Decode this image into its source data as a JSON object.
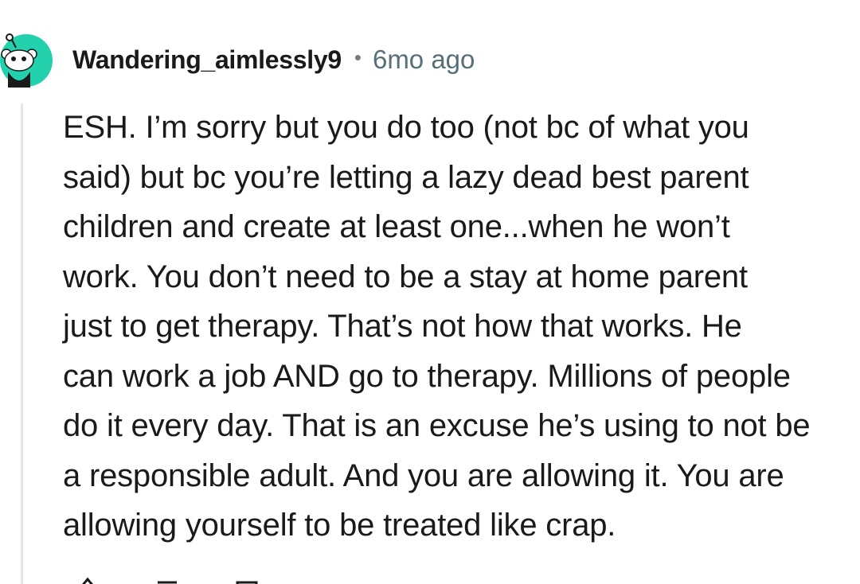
{
  "comment": {
    "author": "Wandering_aimlessly9",
    "separator": "•",
    "timestamp": "6mo ago",
    "body_lines": [
      "ESH. I’m sorry but you do too (not bc of what you",
      "said) but bc you’re letting a lazy dead best parent",
      "children and create at least one...when he won’t",
      "work. You don’t need to be a stay at home parent",
      "just to get therapy. That’s not how that works. He",
      "can work a job AND go to therapy. Millions of people",
      "do it every day. That is an excuse he’s using to not be",
      "a responsible adult. And you are allowing it. You are",
      "allowing yourself to be treated like crap."
    ]
  },
  "avatar": {
    "icon": "snoo-avatar-icon",
    "background_color": "#24d1ad"
  },
  "actions": {
    "icons": [
      "upvote-icon",
      "reply-icon",
      "share-icon"
    ]
  }
}
